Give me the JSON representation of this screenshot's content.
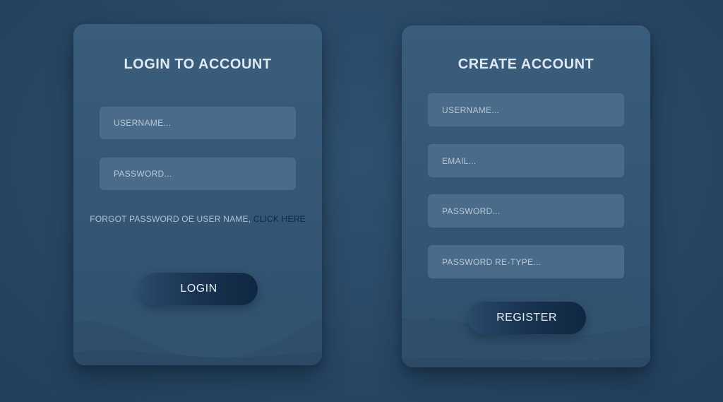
{
  "login": {
    "title": "LOGIN TO ACCOUNT",
    "username_placeholder": "USERNAME...",
    "password_placeholder": "PASSWORD...",
    "forgot_text": "FORGOT PASSWORD OE USER NAME, ",
    "forgot_link": "CLICK HERE",
    "button_label": "LOGIN"
  },
  "register": {
    "title": "CREATE ACCOUNT",
    "username_placeholder": "USERNAME...",
    "email_placeholder": "EMAIL...",
    "password_placeholder": "PASSWORD...",
    "password_retype_placeholder": "PASSWORD RE-TYPE...",
    "button_label": "REGISTER"
  },
  "colors": {
    "background": "#2a4a68",
    "card": "#3b5d7c",
    "field": "#4a6b89",
    "button": "#12294a",
    "link": "#0e2a45",
    "title_text": "#dfe9f2"
  }
}
